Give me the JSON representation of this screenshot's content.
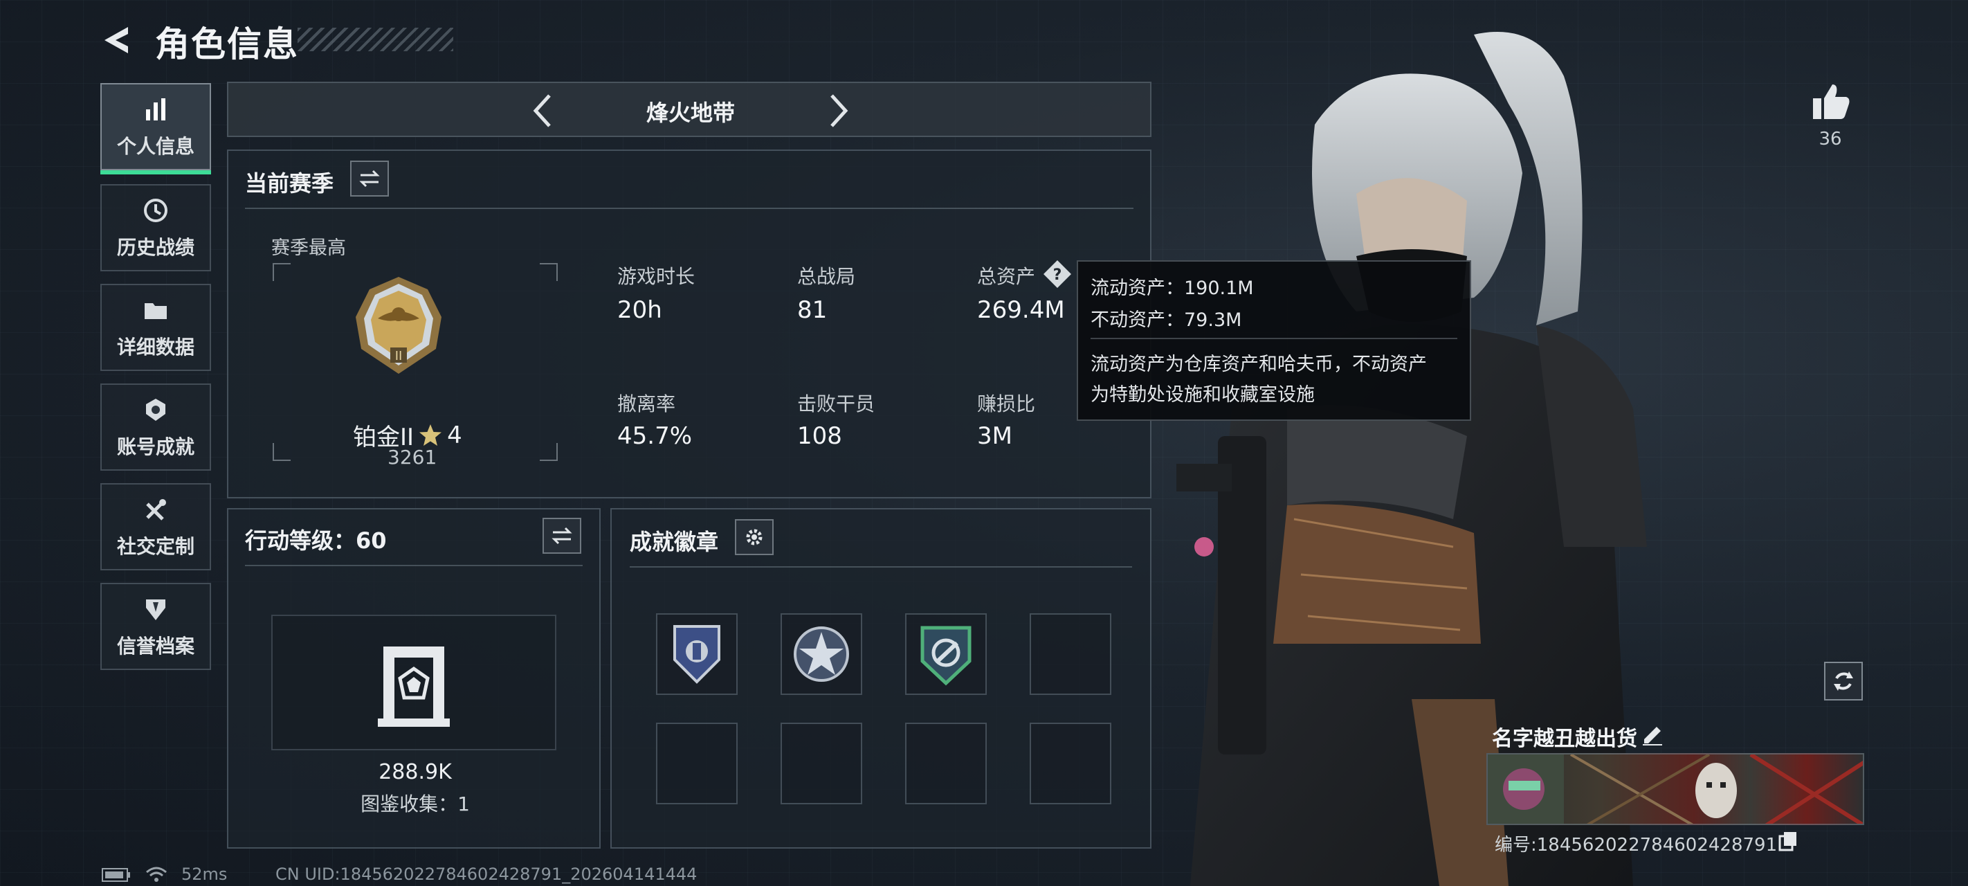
{
  "header": {
    "title": "角色信息"
  },
  "nav": {
    "items": [
      {
        "label": "个人信息",
        "icon": "bar-chart-icon",
        "active": true
      },
      {
        "label": "历史战绩",
        "icon": "history-clock-icon",
        "active": false
      },
      {
        "label": "详细数据",
        "icon": "folder-icon",
        "active": false
      },
      {
        "label": "账号成就",
        "icon": "achievement-icon",
        "active": false
      },
      {
        "label": "社交定制",
        "icon": "tools-icon",
        "active": false
      },
      {
        "label": "信誉档案",
        "icon": "credit-shield-icon",
        "active": false
      }
    ]
  },
  "mode": {
    "name": "烽火地带"
  },
  "season": {
    "title": "当前赛季",
    "best_label": "赛季最高",
    "rank_name": "铂金II",
    "rank_stars": "4",
    "rank_score": "3261",
    "stats": [
      {
        "label": "游戏时长",
        "value": "20h"
      },
      {
        "label": "总战局",
        "value": "81"
      },
      {
        "label": "总资产",
        "value": "269.4M"
      },
      {
        "label": "撤离率",
        "value": "45.7%"
      },
      {
        "label": "击败干员",
        "value": "108"
      },
      {
        "label": "赚损比",
        "value": "3M"
      }
    ]
  },
  "tooltip": {
    "liquid": "流动资产：190.1M",
    "fixed": "不动资产：79.3M",
    "desc_line1": "流动资产为仓库资产和哈夫币，不动资产",
    "desc_line2": "为特勤处设施和收藏室设施"
  },
  "action_level": {
    "title": "行动等级：60",
    "value": "288.9K",
    "collection": "图鉴收集：1"
  },
  "achievements": {
    "title": "成就徽章",
    "badges": [
      "police-shield-badge",
      "star-emblem-badge",
      "green-shield-badge"
    ],
    "empty_slots": 5
  },
  "profile": {
    "likes": "36",
    "name": "名字越丑越出货",
    "id": "编号:184562022784602428791"
  },
  "footer": {
    "ping": "52ms",
    "uid": "CN UID:184562022784602428791_202604141444"
  },
  "colors": {
    "accent": "#3ddc97",
    "panel": "#1c242c",
    "gold": "#c9a65a"
  }
}
